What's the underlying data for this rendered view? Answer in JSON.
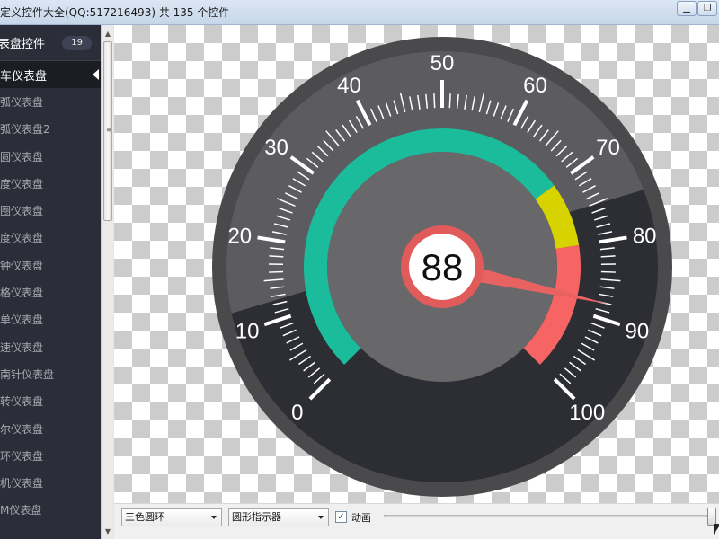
{
  "window": {
    "title": "定义控件大全(QQ:517216493) 共 135 个控件",
    "minimize_icon": "minimize-icon",
    "restore_icon": "restore-icon"
  },
  "sidebar": {
    "header_label": "表盘控件",
    "header_count": "19",
    "items": [
      {
        "label": "车仪表盘",
        "active": true
      },
      {
        "label": "弧仪表盘",
        "active": false
      },
      {
        "label": "弧仪表盘2",
        "active": false
      },
      {
        "label": "圆仪表盘",
        "active": false
      },
      {
        "label": "度仪表盘",
        "active": false
      },
      {
        "label": "圈仪表盘",
        "active": false
      },
      {
        "label": "度仪表盘",
        "active": false
      },
      {
        "label": "钟仪表盘",
        "active": false
      },
      {
        "label": "格仪表盘",
        "active": false
      },
      {
        "label": "单仪表盘",
        "active": false
      },
      {
        "label": "速仪表盘",
        "active": false
      },
      {
        "label": "南针仪表盘",
        "active": false
      },
      {
        "label": "转仪表盘",
        "active": false
      },
      {
        "label": "尔仪表盘",
        "active": false
      },
      {
        "label": "环仪表盘",
        "active": false
      },
      {
        "label": "机仪表盘",
        "active": false
      },
      {
        "label": "M仪表盘",
        "active": false
      }
    ]
  },
  "gauge": {
    "value": "88",
    "value_num": 88,
    "min": 0,
    "max": 100,
    "tick_labels": [
      "0",
      "10",
      "20",
      "30",
      "40",
      "50",
      "60",
      "70",
      "80",
      "90",
      "100"
    ],
    "ring_segments": [
      {
        "from": 0,
        "to": 70,
        "color": "#1abc9c"
      },
      {
        "from": 70,
        "to": 80,
        "color": "#d6d300"
      },
      {
        "from": 80,
        "to": 100,
        "color": "#f66464"
      }
    ],
    "colors": {
      "outer": "#4a4a4c",
      "face": "#2d2e34",
      "inner": "#68686b",
      "text": "#ffffff",
      "pointer": "#e86262",
      "center_ring": "#e25b5b",
      "center_text": "#111111"
    }
  },
  "controls": {
    "ring_style": "三色圆环",
    "pointer_style": "圆形指示器",
    "animation_checked": "✓",
    "animation_label": "动画"
  }
}
